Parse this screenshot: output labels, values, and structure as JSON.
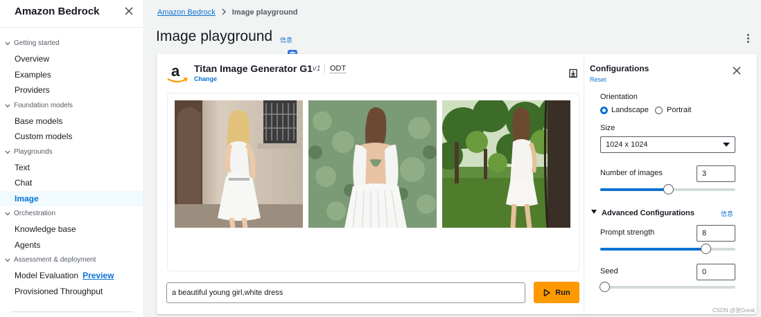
{
  "sidebar": {
    "title": "Amazon Bedrock",
    "groups": [
      {
        "label": "Getting started",
        "items": [
          {
            "label": "Overview"
          },
          {
            "label": "Examples"
          },
          {
            "label": "Providers"
          }
        ]
      },
      {
        "label": "Foundation models",
        "items": [
          {
            "label": "Base models"
          },
          {
            "label": "Custom models"
          }
        ]
      },
      {
        "label": "Playgrounds",
        "items": [
          {
            "label": "Text"
          },
          {
            "label": "Chat"
          },
          {
            "label": "Image"
          }
        ]
      },
      {
        "label": "Orchestration",
        "items": [
          {
            "label": "Knowledge base"
          },
          {
            "label": "Agents"
          }
        ]
      },
      {
        "label": "Assessment & deployment",
        "items": [
          {
            "label": "Model Evaluation",
            "badge": "Preview"
          },
          {
            "label": "Provisioned Throughput"
          }
        ]
      }
    ],
    "active_item": "Image"
  },
  "breadcrumb": {
    "root": "Amazon Bedrock",
    "current": "Image playground"
  },
  "page": {
    "title": "Image playground",
    "info": "信息",
    "translate_glyph": "文"
  },
  "model": {
    "name": "Titan Image Generator G1",
    "version": "v1",
    "tag": "ODT",
    "change": "Change"
  },
  "prompt": {
    "value": "a beautiful young girl,white dress"
  },
  "run_label": "Run",
  "config": {
    "title": "Configurations",
    "reset": "Reset",
    "orientation_label": "Orientation",
    "orientation_options": [
      "Landscape",
      "Portrait"
    ],
    "orientation_selected": "Landscape",
    "size_label": "Size",
    "size_value": "1024 x 1024",
    "num_images_label": "Number of images",
    "num_images_value": "3",
    "num_images_level": 0.5,
    "advanced_label": "Advanced Configurations",
    "advanced_info": "信息",
    "prompt_strength_label": "Prompt strength",
    "prompt_strength_value": "8",
    "prompt_strength_level": 0.78,
    "seed_label": "Seed",
    "seed_value": "0",
    "seed_level": 0
  },
  "colors": {
    "accent": "#0972d3",
    "run_button": "#ff9900"
  },
  "watermark": "CSDN @张Great"
}
